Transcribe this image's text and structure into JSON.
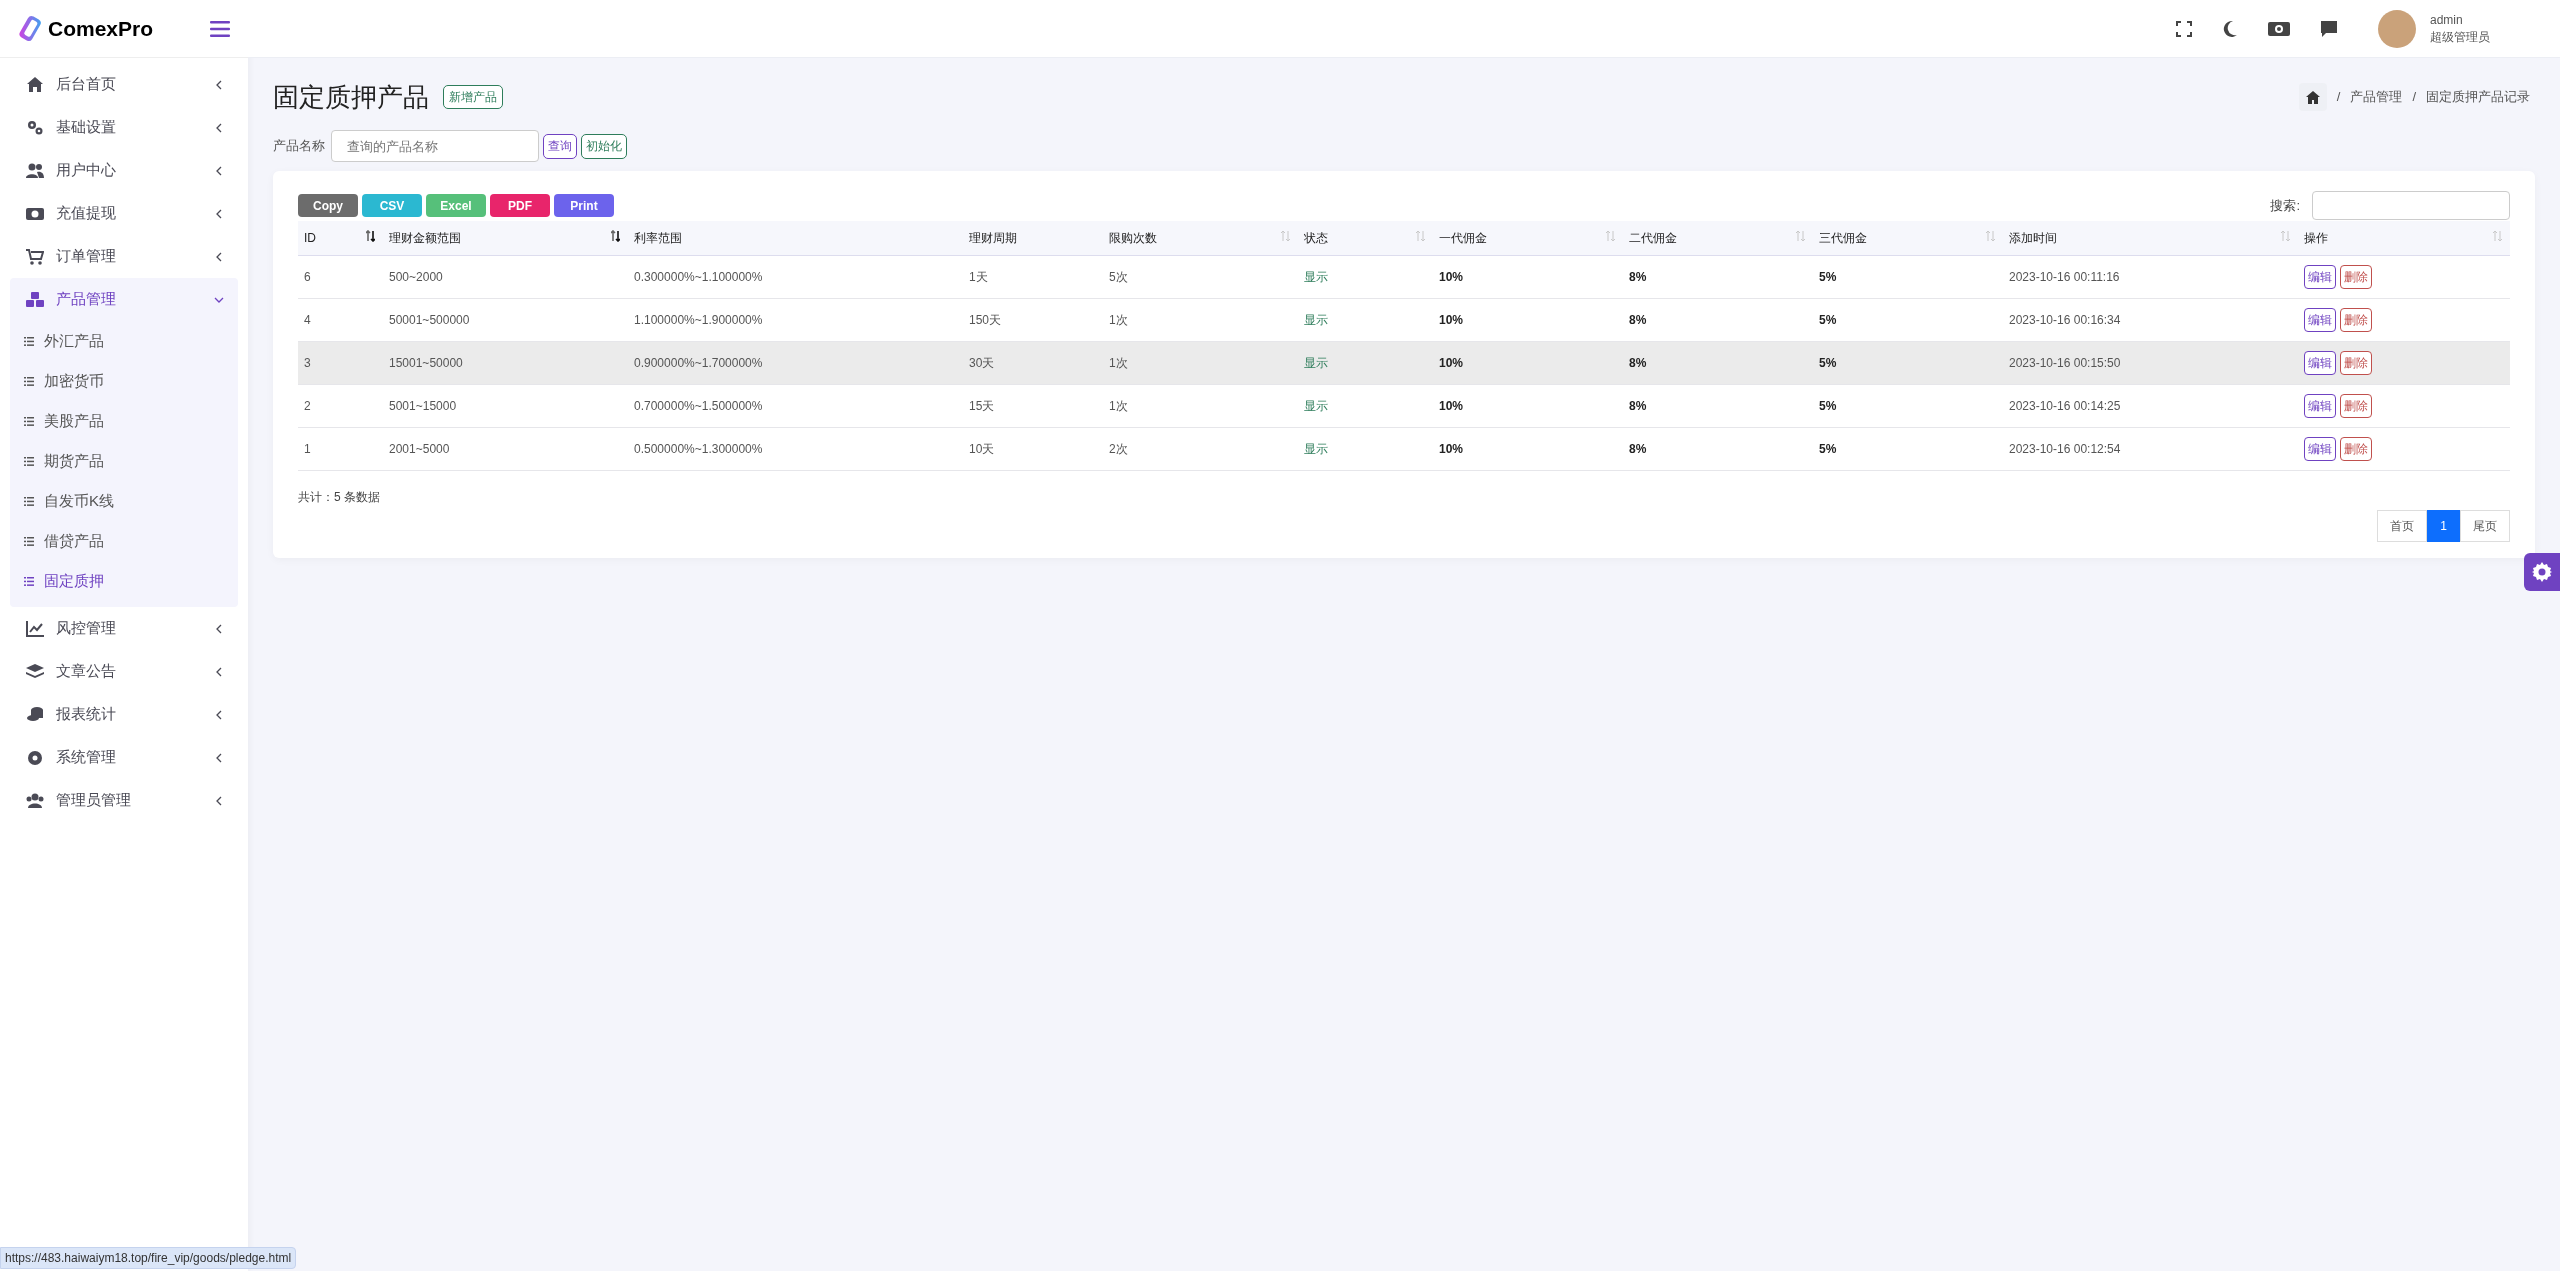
{
  "brand": "ComexPro",
  "sidebar": {
    "items": [
      {
        "label": "后台首页",
        "expanded": false,
        "selected": false
      },
      {
        "label": "基础设置",
        "expanded": false,
        "selected": false
      },
      {
        "label": "用户中心",
        "expanded": false,
        "selected": false
      },
      {
        "label": "充值提现",
        "expanded": false,
        "selected": false
      },
      {
        "label": "订单管理",
        "expanded": false,
        "selected": false
      },
      {
        "label": "产品管理",
        "expanded": true,
        "selected": true,
        "children": [
          {
            "label": "外汇产品",
            "selected": false
          },
          {
            "label": "加密货币",
            "selected": false
          },
          {
            "label": "美股产品",
            "selected": false
          },
          {
            "label": "期货产品",
            "selected": false
          },
          {
            "label": "自发币K线",
            "selected": false
          },
          {
            "label": "借贷产品",
            "selected": false
          },
          {
            "label": "固定质押",
            "selected": true
          }
        ]
      },
      {
        "label": "风控管理",
        "expanded": false,
        "selected": false
      },
      {
        "label": "文章公告",
        "expanded": false,
        "selected": false
      },
      {
        "label": "报表统计",
        "expanded": false,
        "selected": false
      },
      {
        "label": "系统管理",
        "expanded": false,
        "selected": false
      },
      {
        "label": "管理员管理",
        "expanded": false,
        "selected": false
      }
    ]
  },
  "user": {
    "name": "admin",
    "role": "超级管理员"
  },
  "page": {
    "title": "固定质押产品",
    "add_button": "新增产品",
    "breadcrumb": [
      {
        "separator": "/",
        "label": "产品管理"
      },
      {
        "separator": "/",
        "label": "固定质押产品记录"
      }
    ]
  },
  "filter": {
    "label": "产品名称",
    "placeholder": "查询的产品名称",
    "query_button": "查询",
    "reset_button": "初始化"
  },
  "export_buttons": [
    {
      "label": "Copy",
      "color": "#6c6c6c"
    },
    {
      "label": "CSV",
      "color": "#2bb8d1"
    },
    {
      "label": "Excel",
      "color": "#56c07a"
    },
    {
      "label": "PDF",
      "color": "#e8256b"
    },
    {
      "label": "Print",
      "color": "#6c63ec"
    }
  ],
  "search": {
    "label": "搜索:"
  },
  "table": {
    "columns": [
      {
        "label": "ID",
        "sortable": true,
        "sorted": true
      },
      {
        "label": "理财金额范围",
        "sortable": true,
        "sorted": true
      },
      {
        "label": "利率范围",
        "sortable": false
      },
      {
        "label": "理财周期",
        "sortable": false
      },
      {
        "label": "限购次数",
        "sortable": true,
        "sorted": false
      },
      {
        "label": "状态",
        "sortable": true,
        "sorted": false
      },
      {
        "label": "一代佣金",
        "sortable": true,
        "sorted": false
      },
      {
        "label": "二代佣金",
        "sortable": true,
        "sorted": false
      },
      {
        "label": "三代佣金",
        "sortable": true,
        "sorted": false
      },
      {
        "label": "添加时间",
        "sortable": true,
        "sorted": false
      },
      {
        "label": "操作",
        "sortable": true,
        "sorted": false
      }
    ],
    "rows": [
      {
        "highlighted": false,
        "cells": [
          "6",
          "500~2000",
          "0.300000%~1.100000%",
          "1天",
          "5次",
          "显示",
          "10%",
          "8%",
          "5%",
          "2023-10-16 00:11:16"
        ],
        "actions": [
          "编辑",
          "删除"
        ]
      },
      {
        "highlighted": false,
        "cells": [
          "4",
          "50001~500000",
          "1.100000%~1.900000%",
          "150天",
          "1次",
          "显示",
          "10%",
          "8%",
          "5%",
          "2023-10-16 00:16:34"
        ],
        "actions": [
          "编辑",
          "删除"
        ]
      },
      {
        "highlighted": true,
        "cells": [
          "3",
          "15001~50000",
          "0.900000%~1.700000%",
          "30天",
          "1次",
          "显示",
          "10%",
          "8%",
          "5%",
          "2023-10-16 00:15:50"
        ],
        "actions": [
          "编辑",
          "删除"
        ]
      },
      {
        "highlighted": false,
        "cells": [
          "2",
          "5001~15000",
          "0.700000%~1.500000%",
          "15天",
          "1次",
          "显示",
          "10%",
          "8%",
          "5%",
          "2023-10-16 00:14:25"
        ],
        "actions": [
          "编辑",
          "删除"
        ]
      },
      {
        "highlighted": false,
        "cells": [
          "1",
          "2001~5000",
          "0.500000%~1.300000%",
          "10天",
          "2次",
          "显示",
          "10%",
          "8%",
          "5%",
          "2023-10-16 00:12:54"
        ],
        "actions": [
          "编辑",
          "删除"
        ]
      }
    ],
    "total": "共计：5 条数据"
  },
  "pagination": [
    {
      "label": "首页",
      "selected": false
    },
    {
      "label": "1",
      "selected": true
    },
    {
      "label": "尾页",
      "selected": false
    }
  ],
  "status_url": "https://483.haiwaiym18.top/fire_vip/goods/pledge.html"
}
